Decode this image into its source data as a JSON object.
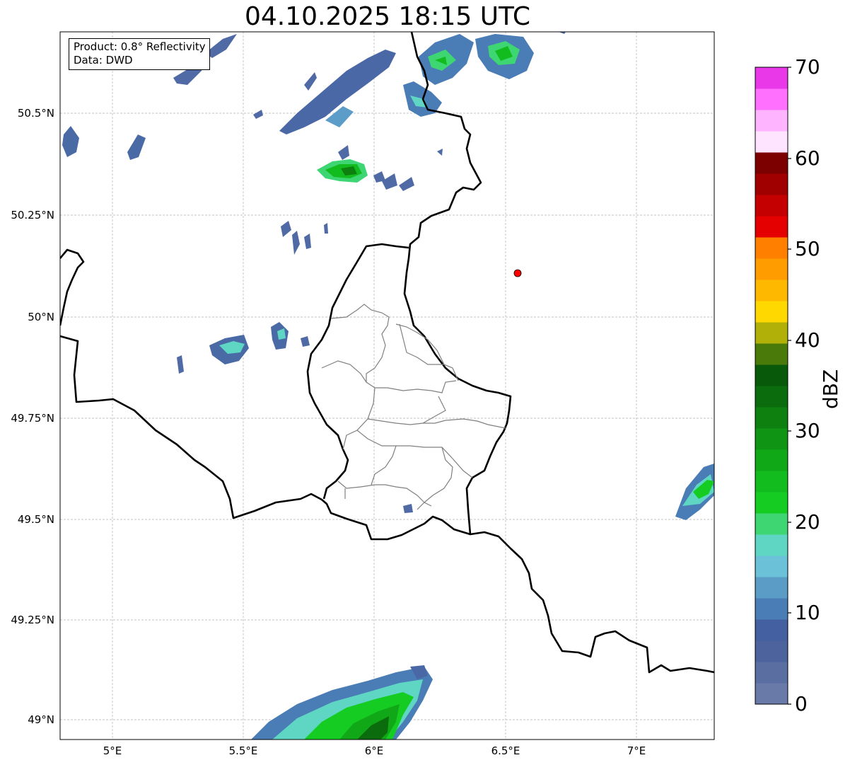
{
  "title": "04.10.2025 18:15 UTC",
  "info_box": {
    "product": "Product: 0.8° Reflectivity",
    "source": "Data: DWD"
  },
  "axes": {
    "lat_labels": [
      "50.5°N",
      "50.25°N",
      "50°N",
      "49.75°N",
      "49.5°N",
      "49.25°N",
      "49°N"
    ],
    "lon_labels": [
      "5°E",
      "5.5°E",
      "6°E",
      "6.5°E",
      "7°E"
    ]
  },
  "colorbar": {
    "unit": "dBZ",
    "tick_labels": [
      "0",
      "10",
      "20",
      "30",
      "40",
      "50",
      "60",
      "70"
    ],
    "range": [
      0,
      70
    ],
    "colors": [
      "#6a7aa8",
      "#5a6ea2",
      "#4d639d",
      "#4560a0",
      "#4a7cb5",
      "#5b9cc6",
      "#6bc2d8",
      "#5fd6c4",
      "#3dd672",
      "#15cc22",
      "#13bc1e",
      "#11a818",
      "#0f9414",
      "#0d8010",
      "#0a6c0c",
      "#085a0a",
      "#4a7a0a",
      "#b0b008",
      "#ffd800",
      "#ffb800",
      "#ff9c00",
      "#ff8000",
      "#e40000",
      "#c40000",
      "#a00000",
      "#7c0000",
      "#ffe4ff",
      "#ffb4ff",
      "#ff70ff",
      "#e838e8"
    ]
  },
  "map": {
    "marker": {
      "lat": 50.11,
      "lon": 6.55,
      "color": "#ff0000"
    },
    "colors": {
      "border": "#000000",
      "districts": "#808080",
      "grid": "#b0b0b0"
    }
  }
}
